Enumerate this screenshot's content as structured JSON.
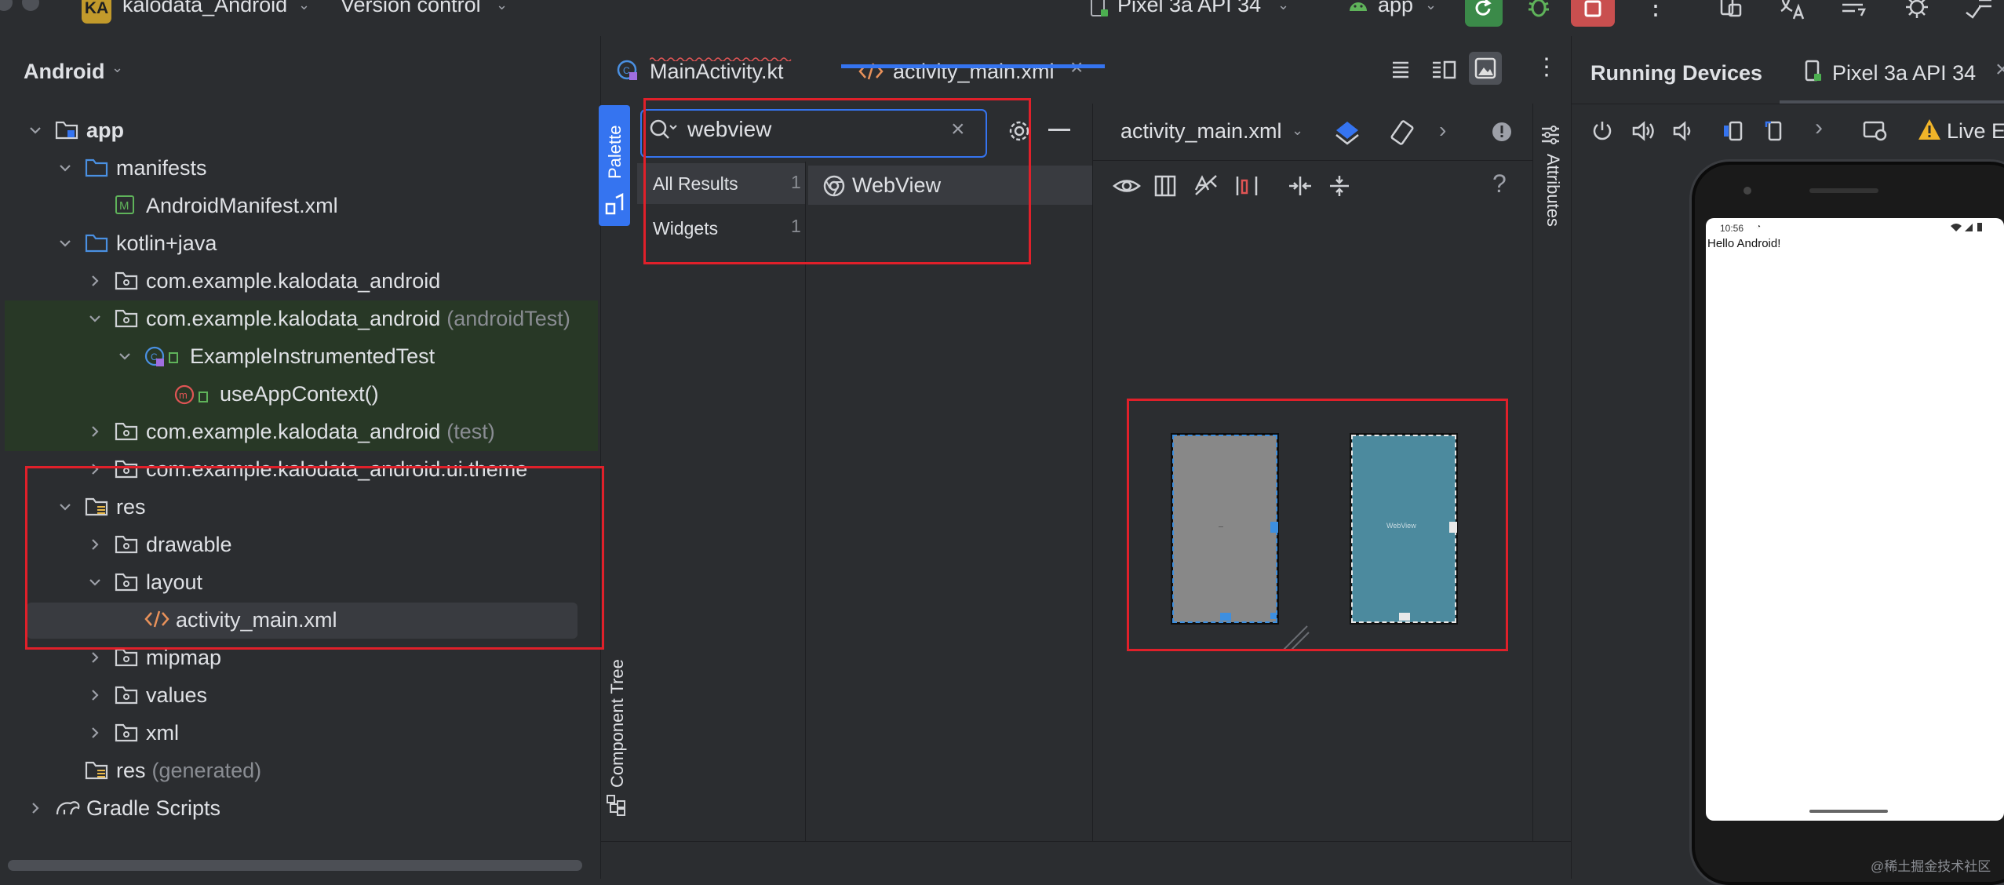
{
  "topbar": {
    "project_badge": "KA",
    "project_name": "kalodata_Android",
    "vcs_label": "Version control",
    "device": "Pixel 3a API 34",
    "run_config": "app"
  },
  "project_panel": {
    "title": "Android",
    "tree": [
      {
        "label": "app",
        "suffix": ""
      },
      {
        "label": "manifests",
        "suffix": ""
      },
      {
        "label": "AndroidManifest.xml",
        "suffix": ""
      },
      {
        "label": "kotlin+java",
        "suffix": ""
      },
      {
        "label": "com.example.kalodata_android",
        "suffix": ""
      },
      {
        "label": "com.example.kalodata_android",
        "suffix": "(androidTest)"
      },
      {
        "label": "ExampleInstrumentedTest",
        "suffix": ""
      },
      {
        "label": "useAppContext()",
        "suffix": ""
      },
      {
        "label": "com.example.kalodata_android",
        "suffix": "(test)"
      },
      {
        "label": "com.example.kalodata_android.ui.theme",
        "suffix": ""
      },
      {
        "label": "res",
        "suffix": ""
      },
      {
        "label": "drawable",
        "suffix": ""
      },
      {
        "label": "layout",
        "suffix": ""
      },
      {
        "label": "activity_main.xml",
        "suffix": ""
      },
      {
        "label": "mipmap",
        "suffix": ""
      },
      {
        "label": "values",
        "suffix": ""
      },
      {
        "label": "xml",
        "suffix": ""
      },
      {
        "label": "res",
        "suffix": "(generated)"
      },
      {
        "label": "Gradle Scripts",
        "suffix": ""
      }
    ]
  },
  "editor": {
    "tabs": [
      {
        "label": "MainActivity.kt"
      },
      {
        "label": "activity_main.xml"
      }
    ],
    "palette_label": "Palette",
    "component_tree_label": "Component Tree",
    "attributes_label": "Attributes",
    "search": {
      "value": "webview"
    },
    "categories": [
      {
        "label": "All Results",
        "count": "1"
      },
      {
        "label": "Widgets",
        "count": "1"
      }
    ],
    "results": [
      {
        "label": "WebView"
      }
    ],
    "design_file": "activity_main.xml",
    "preview_caption": "WebView"
  },
  "running_devices": {
    "title": "Running Devices",
    "device_tab": "Pixel 3a API 34",
    "live_edit": "Live Ed",
    "status_time": "10:56",
    "app_text": "Hello Android!"
  },
  "watermark": "@稀土掘金技术社区",
  "colors": {
    "accent": "#3574f0",
    "annotation_red": "#e0202a",
    "run_green": "#3b8a49",
    "stop_red": "#c94f4f",
    "test_highlight": "#283826"
  }
}
